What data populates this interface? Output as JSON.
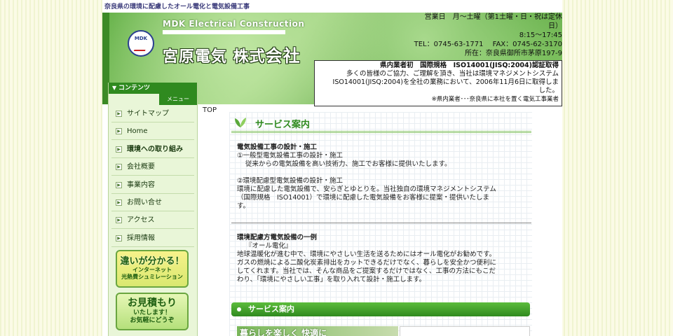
{
  "tagline": "奈良県の環境に配慮したオール電化と電気設備工事",
  "header": {
    "logo_text": "MDK",
    "english_name": "MDK Electrical Construction",
    "japanese_name_main": "宮原電気 株式",
    "japanese_name_suffix": "会社"
  },
  "info": {
    "hours_label": "営業日　月〜土曜（第1土曜・日・祝は定休",
    "hours_label2": "日）",
    "time": "8:15〜17:45",
    "contact": "TEL：0745-63-1771　 FAX：0745-62-3170",
    "address": "所在：奈良県御所市茅原197-9"
  },
  "iso": {
    "title": "県内業者初　国際規格　ISO14001(JISQ:2004)認証取得",
    "body_1": "多くの皆様のご協力、ご理解を頂き、当社は環境マネジメントシステム",
    "body_2": "ISO14001(JISQ:2004)を全社の業務において、2006年11月6日に取得しま",
    "body_3": "した。",
    "note": "※県内業者･･･奈良県に本社を置く電気工事業者"
  },
  "sidebar": {
    "menu_head": "コンテンツ",
    "menu_sub": "メニュー",
    "items": [
      {
        "label": "サイトマップ"
      },
      {
        "label": "Home"
      },
      {
        "label": "環境への取り組み"
      },
      {
        "label": "会社概要"
      },
      {
        "label": "事業内容"
      },
      {
        "label": "お問い合せ"
      },
      {
        "label": "アクセス"
      },
      {
        "label": "採用情報"
      }
    ],
    "banner1_big": "違いが分かる！",
    "banner1_small1": "インターネット",
    "banner1_small2": "光熱費シュミレーション",
    "banner2_big": "お見積もり",
    "banner2_small1": "いたします！",
    "banner2_small2": "お気軽にどうぞ"
  },
  "main": {
    "breadcrumb": "TOP",
    "section_title": "サービス案内",
    "block1": {
      "title": "電気設備工事の設計・施工",
      "l1": "①一般型電気設備工事の設計・施工",
      "l2": "従来からの電気設備を高い技術力、施工でお客様に提供いたします。",
      "l3": "②環境配慮型電気設備の設計・施工",
      "l4": "環境に配慮した電気設備で、安らぎとゆとりを。当社独自の環境マネジメントシステム",
      "l5": "（国際規格　ISO14001）で環境に配慮した電気設備をお客様に提案・提供いたしま",
      "l6": "す。"
    },
    "block2": {
      "title": "環境配慮方電気設備の一例",
      "l1": "『オール電化』",
      "l2": "地球温暖化が進む中で、環境にやさしい生活を送るためにはオール電化がお勧めです。",
      "l3": "ガスの燃焼による二酸化炭素排出をカットできるだけでなく、暮らしを安全かつ便利に",
      "l4": "してくれます。当社では、そんな商品をご提案するだけではなく、工事の方法にもこだ",
      "l5": "わり、「環境にやさしい工事」を取り入れて設計・施工します。"
    },
    "bar_label": "サービス案内",
    "photo_caption": "暮らしを楽しく 快適に"
  }
}
